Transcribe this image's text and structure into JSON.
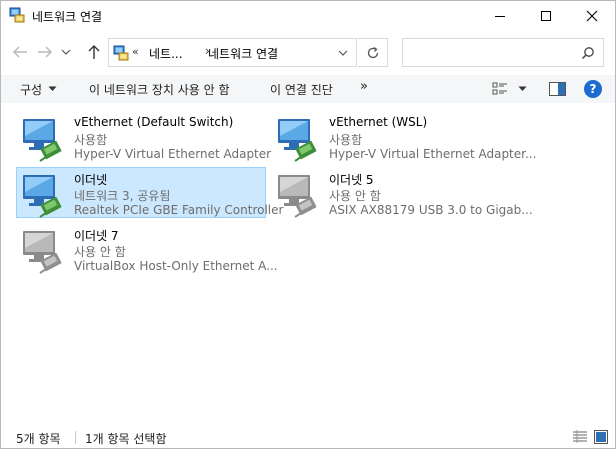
{
  "window": {
    "title": "네트워크 연결",
    "icon": "network-connections-icon"
  },
  "address": {
    "overflow": "«",
    "crumbs": [
      "네트...",
      "네트워크 연결"
    ],
    "separator": "›",
    "search_placeholder": ""
  },
  "toolbar": {
    "organize": "구성",
    "disable": "이 네트워크 장치 사용 안 함",
    "diagnose": "이 연결 진단",
    "more": "»",
    "help": "?"
  },
  "connections": [
    {
      "name": "vEthernet (Default Switch)",
      "status": "사용함",
      "device": "Hyper-V Virtual Ethernet Adapter",
      "enabled": true,
      "selected": false
    },
    {
      "name": "vEthernet (WSL)",
      "status": "사용함",
      "device": "Hyper-V Virtual Ethernet Adapter...",
      "enabled": true,
      "selected": false
    },
    {
      "name": "이더넷",
      "status": "네트워크 3, 공유됨",
      "device": "Realtek PCIe GBE Family Controller",
      "enabled": true,
      "selected": true
    },
    {
      "name": "이더넷 5",
      "status": "사용 안 함",
      "device": "ASIX AX88179 USB 3.0 to Gigab...",
      "enabled": false,
      "selected": false
    },
    {
      "name": "이더넷 7",
      "status": "사용 안 함",
      "device": "VirtualBox Host-Only Ethernet A...",
      "enabled": false,
      "selected": false
    }
  ],
  "statusbar": {
    "count": "5개 항목",
    "selected": "1개 항목 선택함"
  },
  "colors": {
    "selection_bg": "#cce8ff",
    "selection_border": "#99d1ff",
    "secondary_text": "#6d6d6d",
    "help_blue": "#1c6bd1"
  }
}
